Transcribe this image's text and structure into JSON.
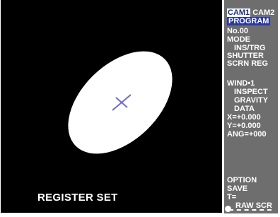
{
  "screen": {
    "status_label": "REGISTER SET"
  },
  "panel": {
    "cam1": "CAM1",
    "cam2": "CAM2",
    "program": "PROGRAM",
    "number": "No.00",
    "mode": "MODE",
    "ins_trg": "INS/TRG",
    "shutter": "SHUTTER",
    "scrn_reg": "SCRN REG",
    "wind": "WIND•1",
    "inspect": "INSPECT",
    "gravity": "GRAVITY",
    "data": "DATA",
    "x_value": "X=+0.000",
    "y_value": "Y=+0.000",
    "ang_value": "ANG=+000",
    "option": "OPTION",
    "save": "SAVE",
    "t_value": "T=",
    "raw_scr": "RAW SCR"
  }
}
